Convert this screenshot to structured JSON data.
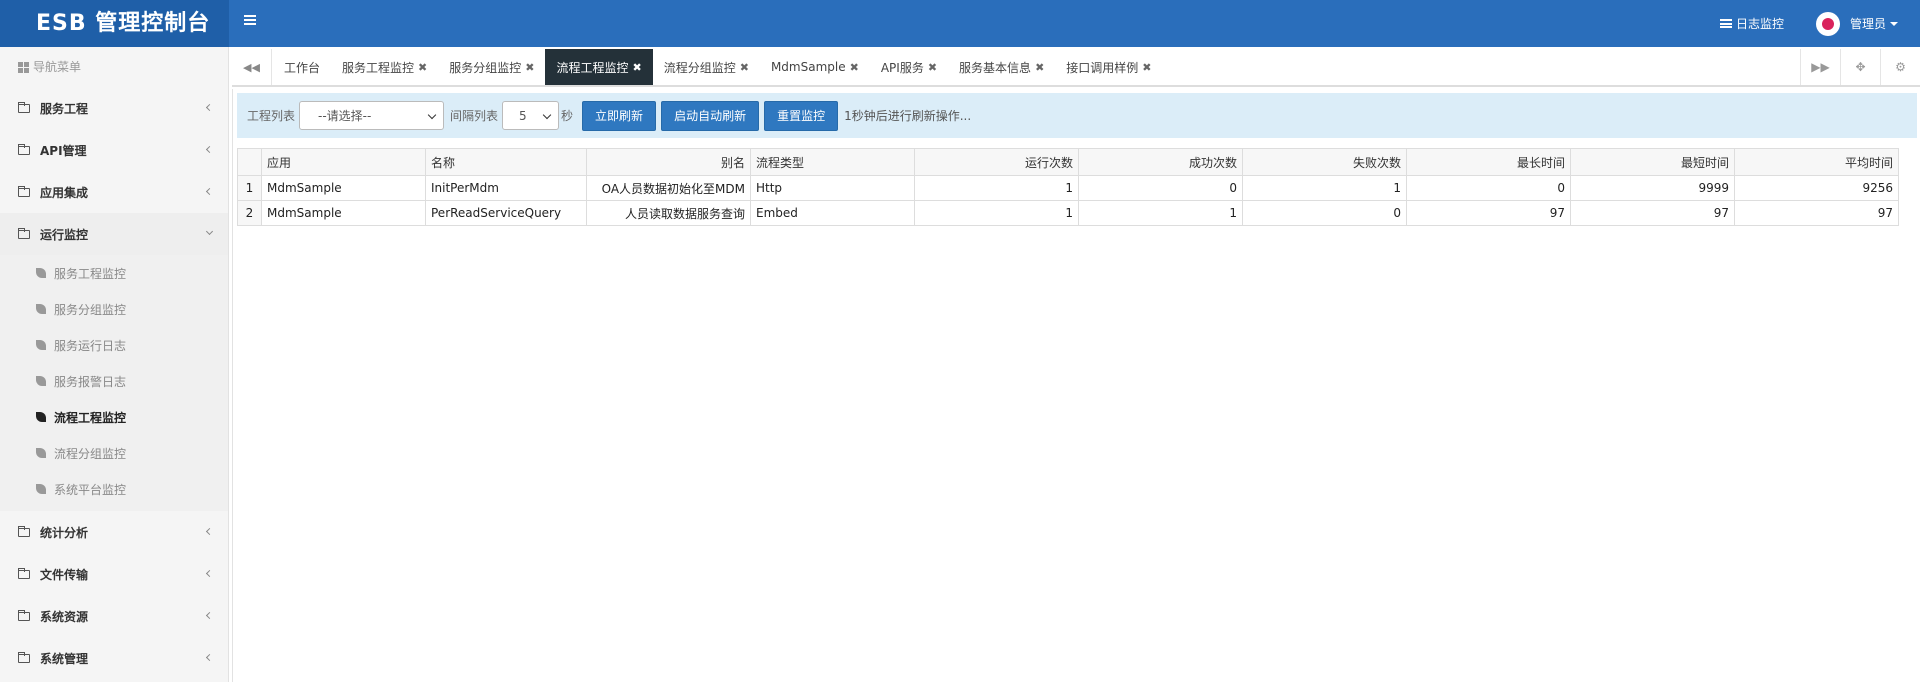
{
  "header": {
    "title": "ESB 管理控制台",
    "log_monitor": "日志监控",
    "user": "管理员"
  },
  "sidebar": {
    "title": "导航菜单",
    "items": [
      {
        "label": "服务工程"
      },
      {
        "label": "API管理"
      },
      {
        "label": "应用集成"
      },
      {
        "label": "运行监控"
      },
      {
        "label": "统计分析"
      },
      {
        "label": "文件传输"
      },
      {
        "label": "系统资源"
      },
      {
        "label": "系统管理"
      }
    ],
    "subitems": [
      {
        "label": "服务工程监控"
      },
      {
        "label": "服务分组监控"
      },
      {
        "label": "服务运行日志"
      },
      {
        "label": "服务报警日志"
      },
      {
        "label": "流程工程监控"
      },
      {
        "label": "流程分组监控"
      },
      {
        "label": "系统平台监控"
      }
    ]
  },
  "tabs": [
    {
      "label": "工作台"
    },
    {
      "label": "服务工程监控"
    },
    {
      "label": "服务分组监控"
    },
    {
      "label": "流程工程监控"
    },
    {
      "label": "流程分组监控"
    },
    {
      "label": "MdmSample"
    },
    {
      "label": "API服务"
    },
    {
      "label": "服务基本信息"
    },
    {
      "label": "接口调用样例"
    }
  ],
  "toolbar": {
    "project_label": "工程列表",
    "project_value": "--请选择--",
    "interval_label": "间隔列表",
    "interval_value": "5",
    "seconds": "秒",
    "refresh_now": "立即刷新",
    "auto_refresh": "启动自动刷新",
    "reset": "重置监控",
    "tip": "1秒钟后进行刷新操作..."
  },
  "table": {
    "columns": [
      "应用",
      "名称",
      "别名",
      "流程类型",
      "运行次数",
      "成功次数",
      "失败次数",
      "最长时间",
      "最短时间",
      "平均时间"
    ],
    "rows": [
      {
        "n": "1",
        "app": "MdmSample",
        "name": "InitPerMdm",
        "alias": "OA人员数据初始化至MDM",
        "type": "Http",
        "runs": "1",
        "success": "0",
        "fail": "1",
        "max": "0",
        "min": "9999",
        "avg": "9256"
      },
      {
        "n": "2",
        "app": "MdmSample",
        "name": "PerReadServiceQuery",
        "alias": "人员读取数据服务查询",
        "type": "Embed",
        "runs": "1",
        "success": "1",
        "fail": "0",
        "max": "97",
        "min": "97",
        "avg": "97"
      }
    ]
  }
}
